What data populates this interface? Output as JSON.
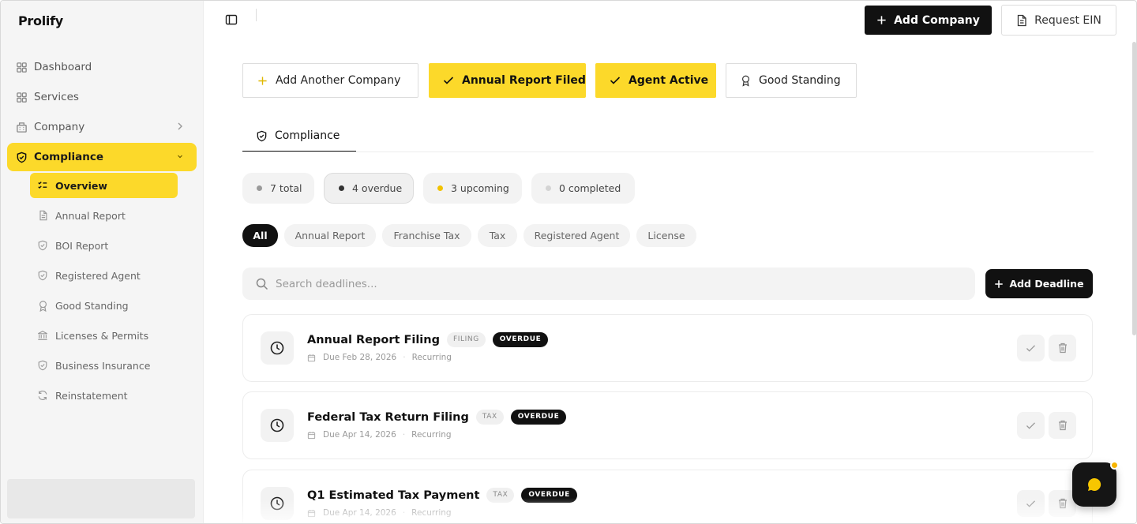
{
  "brand": "Prolify",
  "sidebar": {
    "items": [
      {
        "label": "Dashboard",
        "icon": "grid-icon"
      },
      {
        "label": "Services",
        "icon": "grid-icon"
      },
      {
        "label": "Company",
        "icon": "building-icon"
      },
      {
        "label": "Compliance",
        "icon": "shield-check-icon"
      }
    ],
    "sub_items": [
      {
        "label": "Overview",
        "icon": "list-check-icon"
      },
      {
        "label": "Annual Report",
        "icon": "document-icon"
      },
      {
        "label": "BOI Report",
        "icon": "shield-icon"
      },
      {
        "label": "Registered Agent",
        "icon": "shield-icon"
      },
      {
        "label": "Good Standing",
        "icon": "award-icon"
      },
      {
        "label": "Licenses & Permits",
        "icon": "landmark-icon"
      },
      {
        "label": "Business Insurance",
        "icon": "shield-icon"
      },
      {
        "label": "Reinstatement",
        "icon": "refresh-icon"
      }
    ]
  },
  "header": {
    "add_company": "Add Company",
    "request_ein": "Request EIN"
  },
  "status_buttons": [
    {
      "label": "Add Another Company",
      "icon": "plus-icon",
      "style": "outline"
    },
    {
      "label": "Annual Report Filed",
      "icon": "check-icon",
      "style": "yellow"
    },
    {
      "label": "Agent Active",
      "icon": "check-icon",
      "style": "yellow"
    },
    {
      "label": "Good Standing",
      "icon": "award-icon",
      "style": "outline"
    }
  ],
  "tab": {
    "label": "Compliance"
  },
  "counters": [
    {
      "label": "7 total",
      "dot_color": "#9a9a9a"
    },
    {
      "label": "4 overdue",
      "dot_color": "#333333"
    },
    {
      "label": "3 upcoming",
      "dot_color": "#f2c200"
    },
    {
      "label": "0 completed",
      "dot_color": "#d4d4d4"
    }
  ],
  "filters": [
    "All",
    "Annual Report",
    "Franchise Tax",
    "Tax",
    "Registered Agent",
    "License"
  ],
  "search": {
    "placeholder": "Search deadlines..."
  },
  "add_deadline": "Add Deadline",
  "deadlines": [
    {
      "title": "Annual Report Filing",
      "tag": "FILING",
      "status": "OVERDUE",
      "due": "Due Feb 28, 2026",
      "recurrence": "Recurring"
    },
    {
      "title": "Federal Tax Return Filing",
      "tag": "TAX",
      "status": "OVERDUE",
      "due": "Due Apr 14, 2026",
      "recurrence": "Recurring"
    },
    {
      "title": "Q1 Estimated Tax Payment",
      "tag": "TAX",
      "status": "OVERDUE",
      "due": "Due Apr 14, 2026",
      "recurrence": "Recurring"
    }
  ],
  "colors": {
    "accent": "#fcd92a",
    "dark": "#111111",
    "notification": "#f7b500"
  }
}
